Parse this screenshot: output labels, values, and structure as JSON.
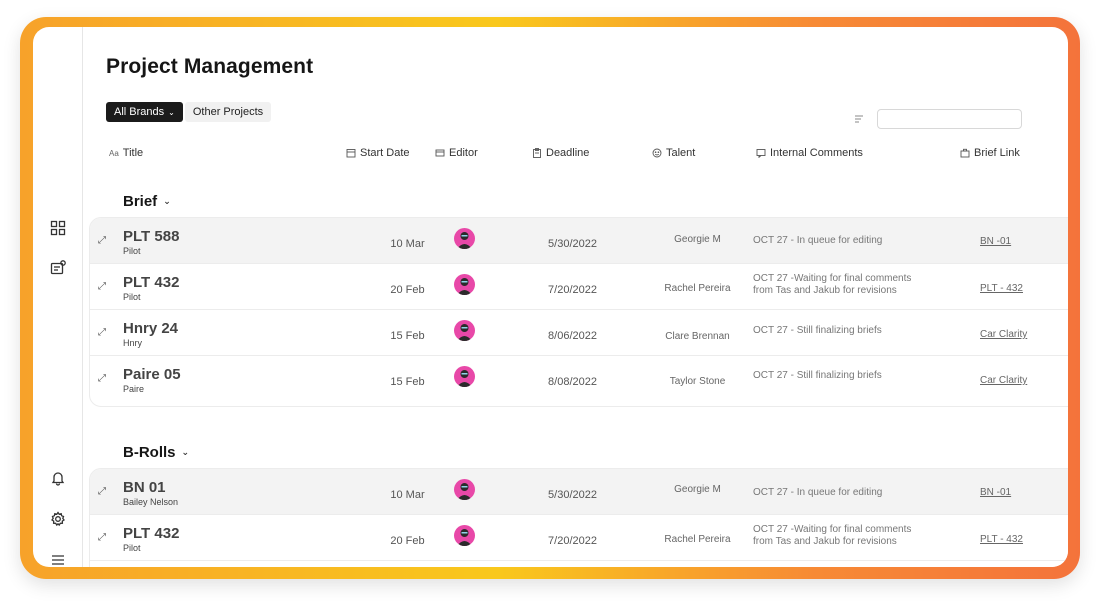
{
  "page": {
    "title": "Project Management"
  },
  "filters": {
    "all_brands": "All Brands",
    "other_projects": "Other Projects"
  },
  "search": {
    "placeholder": ""
  },
  "columns": {
    "title": "Title",
    "title_icon": "Aa",
    "start_date": "Start Date",
    "editor": "Editor",
    "deadline": "Deadline",
    "talent": "Talent",
    "internal_comments": "Internal Comments",
    "brief_link": "Brief Link"
  },
  "groups": [
    {
      "name": "Brief",
      "rows": [
        {
          "name": "PLT 588",
          "sub": "Pilot",
          "start": "10 Mar",
          "deadline": "5/30/2022",
          "talent": "Georgie M",
          "comment": [
            "OCT 27 - In queue for editing"
          ],
          "link": "BN -01"
        },
        {
          "name": "PLT 432",
          "sub": "Pilot",
          "start": "20 Feb",
          "deadline": "7/20/2022",
          "talent": "Rachel Pereira",
          "comment": [
            "OCT 27 -Waiting for final comments",
            "from Tas and Jakub for revisions"
          ],
          "link": "PLT - 432"
        },
        {
          "name": "Hnry 24",
          "sub": "Hnry",
          "start": "15 Feb",
          "deadline": "8/06/2022",
          "talent": "Clare Brennan",
          "comment": [
            "OCT 27 - Still finalizing briefs"
          ],
          "link": "Car Clarity"
        },
        {
          "name": "Paire 05",
          "sub": "Paire",
          "start": "15 Feb",
          "deadline": "8/08/2022",
          "talent": "Taylor Stone",
          "comment": [
            "OCT 27 - Still finalizing briefs"
          ],
          "link": "Car Clarity"
        }
      ]
    },
    {
      "name": "B-Rolls",
      "rows": [
        {
          "name": "BN 01",
          "sub": "Bailey Nelson",
          "start": "10 Mar",
          "deadline": "5/30/2022",
          "talent": "Georgie M",
          "comment": [
            "OCT 27 - In queue for editing"
          ],
          "link": "BN -01"
        },
        {
          "name": "PLT 432",
          "sub": "Pilot",
          "start": "20 Feb",
          "deadline": "7/20/2022",
          "talent": "Rachel Pereira",
          "comment": [
            "OCT 27 -Waiting for final comments",
            "from Tas and Jakub for revisions"
          ],
          "link": "PLT - 432"
        }
      ]
    }
  ],
  "icons": {
    "sidebar": [
      "dashboard-grid-icon",
      "projects-settings-icon",
      "notification-bell-icon",
      "settings-gear-icon",
      "menu-icon"
    ],
    "avatar_color": "#e848a8"
  }
}
